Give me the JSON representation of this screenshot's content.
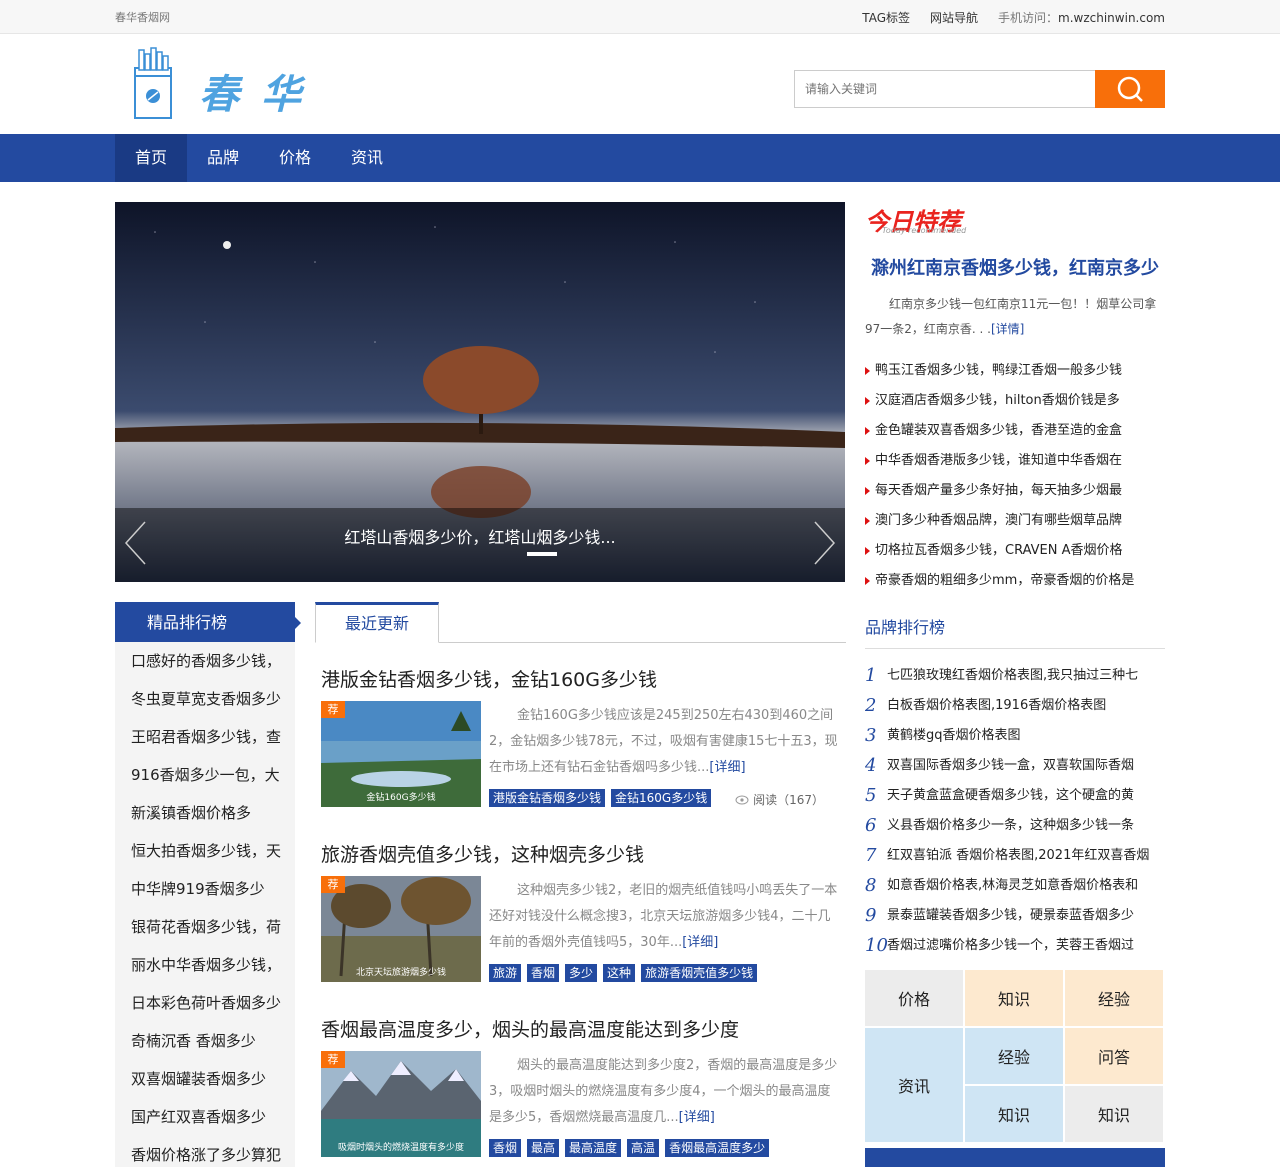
{
  "topbar": {
    "site_name": "春华香烟网",
    "tag_link": "TAG标签",
    "nav_link": "网站导航",
    "mobile_label": "手机访问：",
    "mobile_url": "m.wzchinwin.com"
  },
  "header": {
    "logo_text": "春华",
    "search_placeholder": "请输入关键词"
  },
  "nav": {
    "items": [
      "首页",
      "品牌",
      "价格",
      "资讯"
    ]
  },
  "slider": {
    "caption": "红塔山香烟多少价，红塔山烟多少钱..."
  },
  "today": {
    "logo_main": "今日特荐",
    "logo_sub": "Today recommended",
    "title": "滁州红南京香烟多少钱，红南京多少",
    "desc": "红南京多少钱一包红南京11元一包！！烟草公司拿97一条2，红南京香. . .",
    "more": "[详情]",
    "list": [
      "鸭玉江香烟多少钱，鸭绿江香烟一般多少钱",
      "汉庭酒店香烟多少钱，hilton香烟价钱是多",
      "金色罐装双喜香烟多少钱，香港至造的金盒",
      "中华香烟香港版多少钱，谁知道中华香烟在",
      "每天香烟产量多少条好抽，每天抽多少烟最",
      "澳门多少种香烟品牌，澳门有哪些烟草品牌",
      "切格拉瓦香烟多少钱，CRAVEN A香烟价格",
      "帝豪香烟的粗细多少mm，帝豪香烟的价格是"
    ]
  },
  "left_rank": {
    "title": "精品排行榜",
    "items": [
      "口感好的香烟多少钱，",
      "冬虫夏草宽支香烟多少",
      "王昭君香烟多少钱，查",
      "916香烟多少一包，大",
      "新溪镇香烟价格多",
      "恒大拍香烟多少钱，天",
      "中华牌919香烟多少",
      "银荷花香烟多少钱，荷",
      "丽水中华香烟多少钱，",
      "日本彩色荷叶香烟多少",
      "奇楠沉香 香烟多少",
      "双喜烟罐装香烟多少",
      "国产红双喜香烟多少",
      "香烟价格涨了多少算犯"
    ]
  },
  "recent": {
    "tab": "最近更新",
    "badge": "荐",
    "articles": [
      {
        "title": "港版金钻香烟多少钱，金钻160G多少钱",
        "thumb_caption": "金钻160G多少钱",
        "desc": "金钻160G多少钱应该是245到250左右430到460之间2，金钻烟多少钱78元，不过，吸烟有害健康15七十五3，现在市场上还有钻石金钻香烟吗多少钱...",
        "more": "[详细]",
        "tags": [
          "港版金钻香烟多少钱",
          "金钻160G多少钱"
        ],
        "views": "阅读（167）"
      },
      {
        "title": "旅游香烟壳值多少钱，这种烟壳多少钱",
        "thumb_caption": "北京天坛旅游烟多少钱",
        "desc": "这种烟壳多少钱2，老旧的烟壳纸值钱吗小鸣丢失了一本还好对钱没什么概念搜3，北京天坛旅游烟多少钱4，二十几年前的香烟外壳值钱吗5，30年...",
        "more": "[详细]",
        "tags": [
          "旅游",
          "香烟",
          "多少",
          "这种",
          "旅游香烟壳值多少钱"
        ],
        "views": ""
      },
      {
        "title": "香烟最高温度多少，烟头的最高温度能达到多少度",
        "thumb_caption": "吸烟时烟头的燃烧温度有多少度",
        "desc": "烟头的最高温度能达到多少度2，香烟的最高温度是多少3，吸烟时烟头的燃烧温度有多少度4，一个烟头的最高温度是多少5，香烟燃烧最高温度几...",
        "more": "[详细]",
        "tags": [
          "香烟",
          "最高",
          "最高温度",
          "高温",
          "香烟最高温度多少"
        ],
        "views": ""
      }
    ]
  },
  "brand_rank": {
    "title": "品牌排行榜",
    "items": [
      {
        "n": "1",
        "text": "七匹狼玫瑰红香烟价格表图,我只抽过三种七"
      },
      {
        "n": "2",
        "text": "白板香烟价格表图,1916香烟价格表图"
      },
      {
        "n": "3",
        "text": "黄鹤楼gq香烟价格表图"
      },
      {
        "n": "4",
        "text": "双喜国际香烟多少钱一盒，双喜软国际香烟"
      },
      {
        "n": "5",
        "text": "天子黄盒蓝盒硬香烟多少钱，这个硬盒的黄"
      },
      {
        "n": "6",
        "text": "义县香烟价格多少一条，这种烟多少钱一条"
      },
      {
        "n": "7",
        "text": "红双喜铂派 香烟价格表图,2021年红双喜香烟"
      },
      {
        "n": "8",
        "text": "如意香烟价格表,林海灵芝如意香烟价格表和"
      },
      {
        "n": "9",
        "text": "景泰蓝罐装香烟多少钱，硬景泰蓝香烟多少"
      },
      {
        "n": "10",
        "text": "香烟过滤嘴价格多少钱一个，芙蓉王香烟过"
      }
    ]
  },
  "tag_grid": {
    "cells": [
      "价格",
      "知识",
      "经验",
      "资讯",
      "经验",
      "问答",
      "知识",
      "知识"
    ]
  },
  "colors": {
    "brand_blue": "#234aa0",
    "accent_orange": "#f86f0a",
    "logo_blue": "#4fa3e0",
    "highlight_red": "#e9231e",
    "cell_gray": "#ececec",
    "cell_peach": "#fde9cf",
    "cell_lightblue": "#cfe5f4"
  }
}
